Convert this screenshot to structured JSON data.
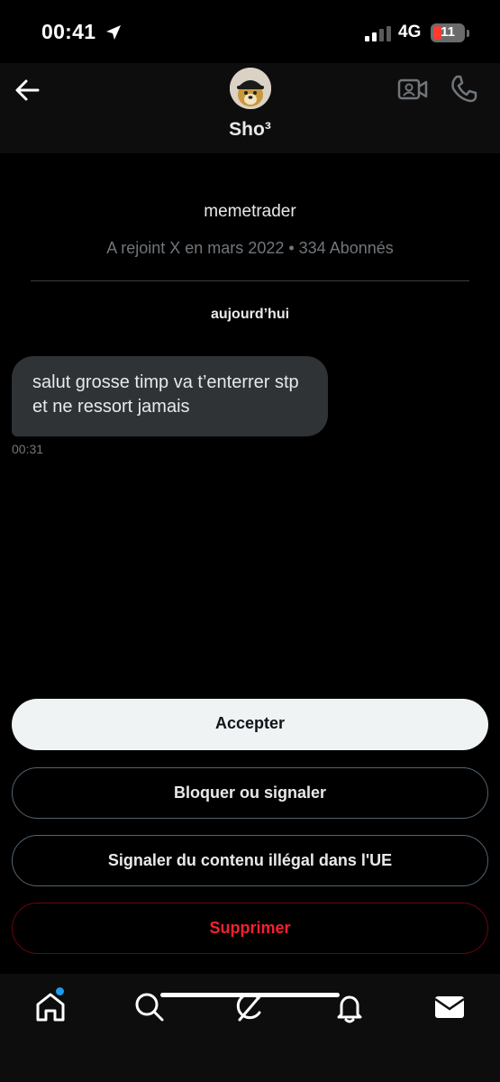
{
  "status_bar": {
    "time": "00:41",
    "network": "4G",
    "battery": "11",
    "icons": [
      "location-arrow-icon",
      "signal-icon",
      "battery-icon"
    ]
  },
  "header": {
    "contact_name": "Sho³",
    "icons": [
      "back-arrow-icon",
      "avatar-image",
      "video-camera-icon",
      "phone-icon"
    ]
  },
  "profile": {
    "handle": "memetrader",
    "meta": "A rejoint X en mars 2022 • 334 Abonnés"
  },
  "conversation": {
    "date_separator": "aujourd’hui",
    "messages": [
      {
        "text": "salut grosse timp va t’enterrer stp et ne ressort jamais",
        "time": "00:31"
      }
    ]
  },
  "actions": {
    "accept": "Accepter",
    "block": "Bloquer ou signaler",
    "report": "Signaler du contenu illégal dans l'UE",
    "delete": "Supprimer"
  },
  "bottom_nav": {
    "items": [
      "home-icon",
      "search-icon",
      "grok-icon",
      "bell-icon",
      "mail-icon"
    ],
    "home_has_notification": true
  },
  "colors": {
    "background": "#000000",
    "bubble": "#2f3336",
    "accept_button": "#eff3f4",
    "delete_text": "#f4212e",
    "notification_dot": "#1d9bf0",
    "muted_text": "#71767b"
  }
}
